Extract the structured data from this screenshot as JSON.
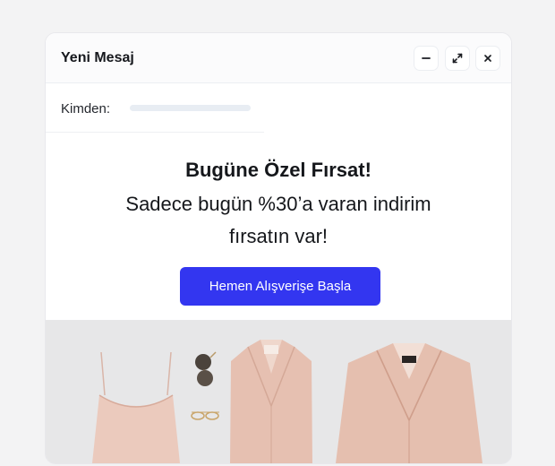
{
  "window": {
    "title": "Yeni Mesaj",
    "controls": [
      {
        "name": "minimize",
        "icon": "minus-icon"
      },
      {
        "name": "expand",
        "icon": "expand-arrows-icon"
      },
      {
        "name": "close",
        "icon": "close-icon"
      }
    ]
  },
  "from": {
    "label": "Kimden:",
    "value": ""
  },
  "email": {
    "headline": "Bugüne Özel Fırsat!",
    "body": "Sadece bugün %30’a varan indirim fırsatın var!",
    "cta_label": "Hemen Alışverişe Başla",
    "hero_image": "clothing-flatlay-image"
  },
  "colors": {
    "accent": "#3336f0",
    "background": "#f3f3f4",
    "window": "#ffffff",
    "garment": "#e6c2b4"
  }
}
